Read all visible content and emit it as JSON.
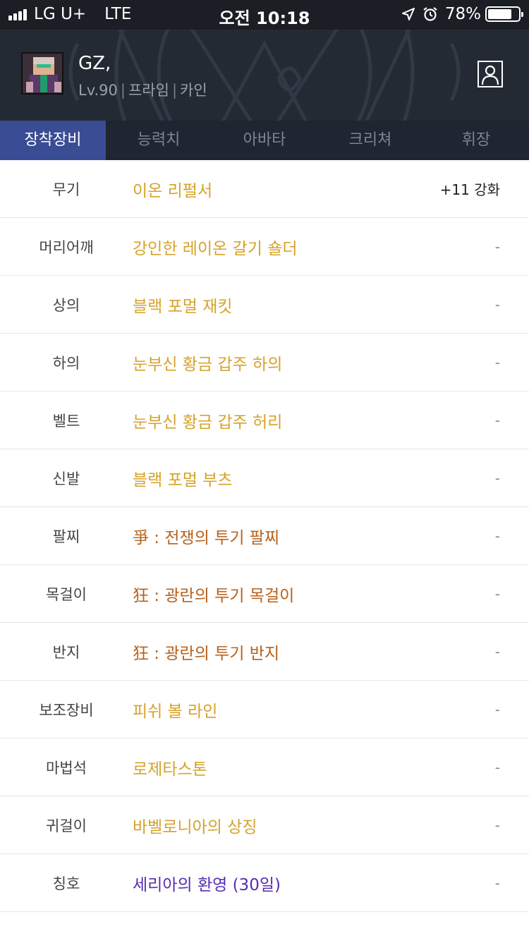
{
  "status_bar": {
    "carrier": "LG U+",
    "network": "LTE",
    "time": "오전 10:18",
    "battery_percent": "78%",
    "battery_level": 0.78
  },
  "profile": {
    "name": "GZ,",
    "level": "Lv.90",
    "class": "프라임",
    "server": "카인",
    "avatar_icon": "character-pixel-avatar",
    "profile_icon": "person-icon"
  },
  "tabs": [
    {
      "label": "장착장비",
      "active": true
    },
    {
      "label": "능력치",
      "active": false
    },
    {
      "label": "아바타",
      "active": false
    },
    {
      "label": "크리쳐",
      "active": false
    },
    {
      "label": "휘장",
      "active": false
    }
  ],
  "equipment": [
    {
      "slot": "무기",
      "item": "이온 리펄서",
      "extra": "+11 강화",
      "grade": "legendary"
    },
    {
      "slot": "머리어깨",
      "item": "강인한 레이온 갈기 숄더",
      "extra": "-",
      "grade": "legendary"
    },
    {
      "slot": "상의",
      "item": "블랙 포멀 재킷",
      "extra": "-",
      "grade": "legendary"
    },
    {
      "slot": "하의",
      "item": "눈부신 황금 갑주 하의",
      "extra": "-",
      "grade": "legendary"
    },
    {
      "slot": "벨트",
      "item": "눈부신 황금 갑주 허리",
      "extra": "-",
      "grade": "legendary"
    },
    {
      "slot": "신발",
      "item": "블랙 포멀 부츠",
      "extra": "-",
      "grade": "legendary"
    },
    {
      "slot": "팔찌",
      "item": "爭 : 전쟁의 투기 팔찌",
      "extra": "-",
      "grade": "unique"
    },
    {
      "slot": "목걸이",
      "item": "狂 : 광란의 투기 목걸이",
      "extra": "-",
      "grade": "unique"
    },
    {
      "slot": "반지",
      "item": "狂 : 광란의 투기 반지",
      "extra": "-",
      "grade": "unique"
    },
    {
      "slot": "보조장비",
      "item": "피쉬 볼 라인",
      "extra": "-",
      "grade": "legendary"
    },
    {
      "slot": "마법석",
      "item": "로제타스톤",
      "extra": "-",
      "grade": "legendary"
    },
    {
      "slot": "귀걸이",
      "item": "바벨로니아의 상징",
      "extra": "-",
      "grade": "legendary"
    },
    {
      "slot": "칭호",
      "item": "세리아의 환영 (30일)",
      "extra": "-",
      "grade": "epic"
    }
  ],
  "colors": {
    "legendary": "#d6a22a",
    "unique": "#b8611b",
    "epic": "#5a2bb6",
    "tab_active": "#3a4c93",
    "header_bg": "#242a33"
  }
}
